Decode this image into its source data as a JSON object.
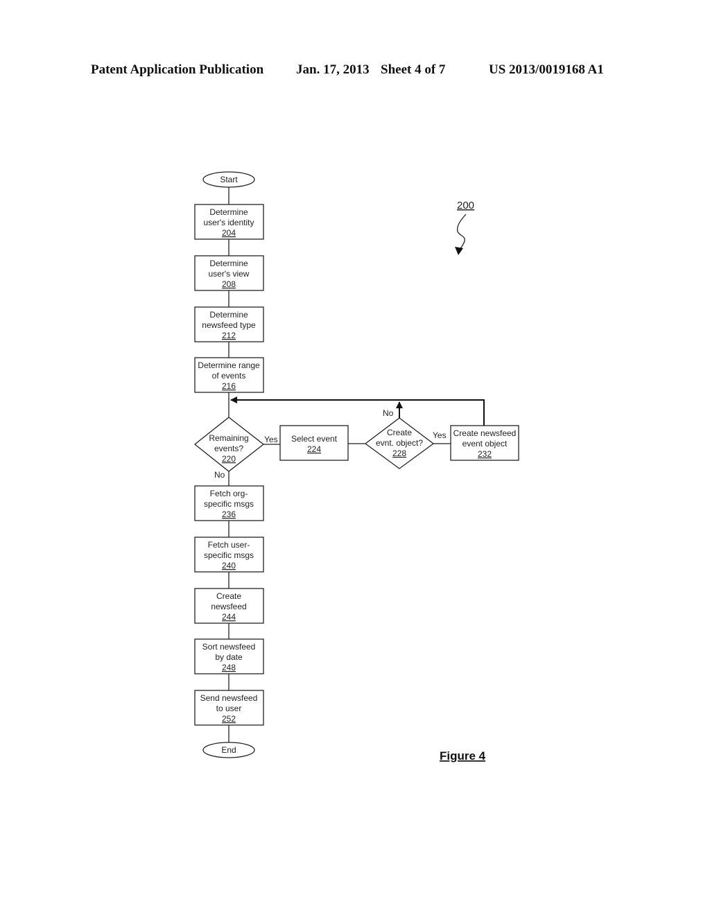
{
  "header": {
    "publication": "Patent Application Publication",
    "date": "Jan. 17, 2013",
    "sheet": "Sheet 4 of 7",
    "patent_number": "US 2013/0019168 A1"
  },
  "figure": {
    "label": "Figure 4",
    "reference": "200"
  },
  "flowchart": {
    "start": "Start",
    "end": "End",
    "steps": {
      "s204": {
        "line1": "Determine",
        "line2": "user's identity",
        "ref": "204"
      },
      "s208": {
        "line1": "Determine",
        "line2": "user's view",
        "ref": "208"
      },
      "s212": {
        "line1": "Determine",
        "line2": "newsfeed type",
        "ref": "212"
      },
      "s216": {
        "line1": "Determine range",
        "line2": "of events",
        "ref": "216"
      },
      "s224": {
        "line1": "Select event",
        "ref": "224"
      },
      "s232": {
        "line1": "Create newsfeed",
        "line2": "event object",
        "ref": "232"
      },
      "s236": {
        "line1": "Fetch org-",
        "line2": "specific msgs",
        "ref": "236"
      },
      "s240": {
        "line1": "Fetch user-",
        "line2": "specific msgs",
        "ref": "240"
      },
      "s244": {
        "line1": "Create",
        "line2": "newsfeed",
        "ref": "244"
      },
      "s248": {
        "line1": "Sort newsfeed",
        "line2": "by date",
        "ref": "248"
      },
      "s252": {
        "line1": "Send newsfeed",
        "line2": "to user",
        "ref": "252"
      }
    },
    "decisions": {
      "d220": {
        "line1": "Remaining",
        "line2": "events?",
        "ref": "220",
        "yes": "Yes",
        "no": "No"
      },
      "d228": {
        "line1": "Create",
        "line2": "evnt. object?",
        "ref": "228",
        "yes": "Yes",
        "no": "No"
      }
    }
  }
}
